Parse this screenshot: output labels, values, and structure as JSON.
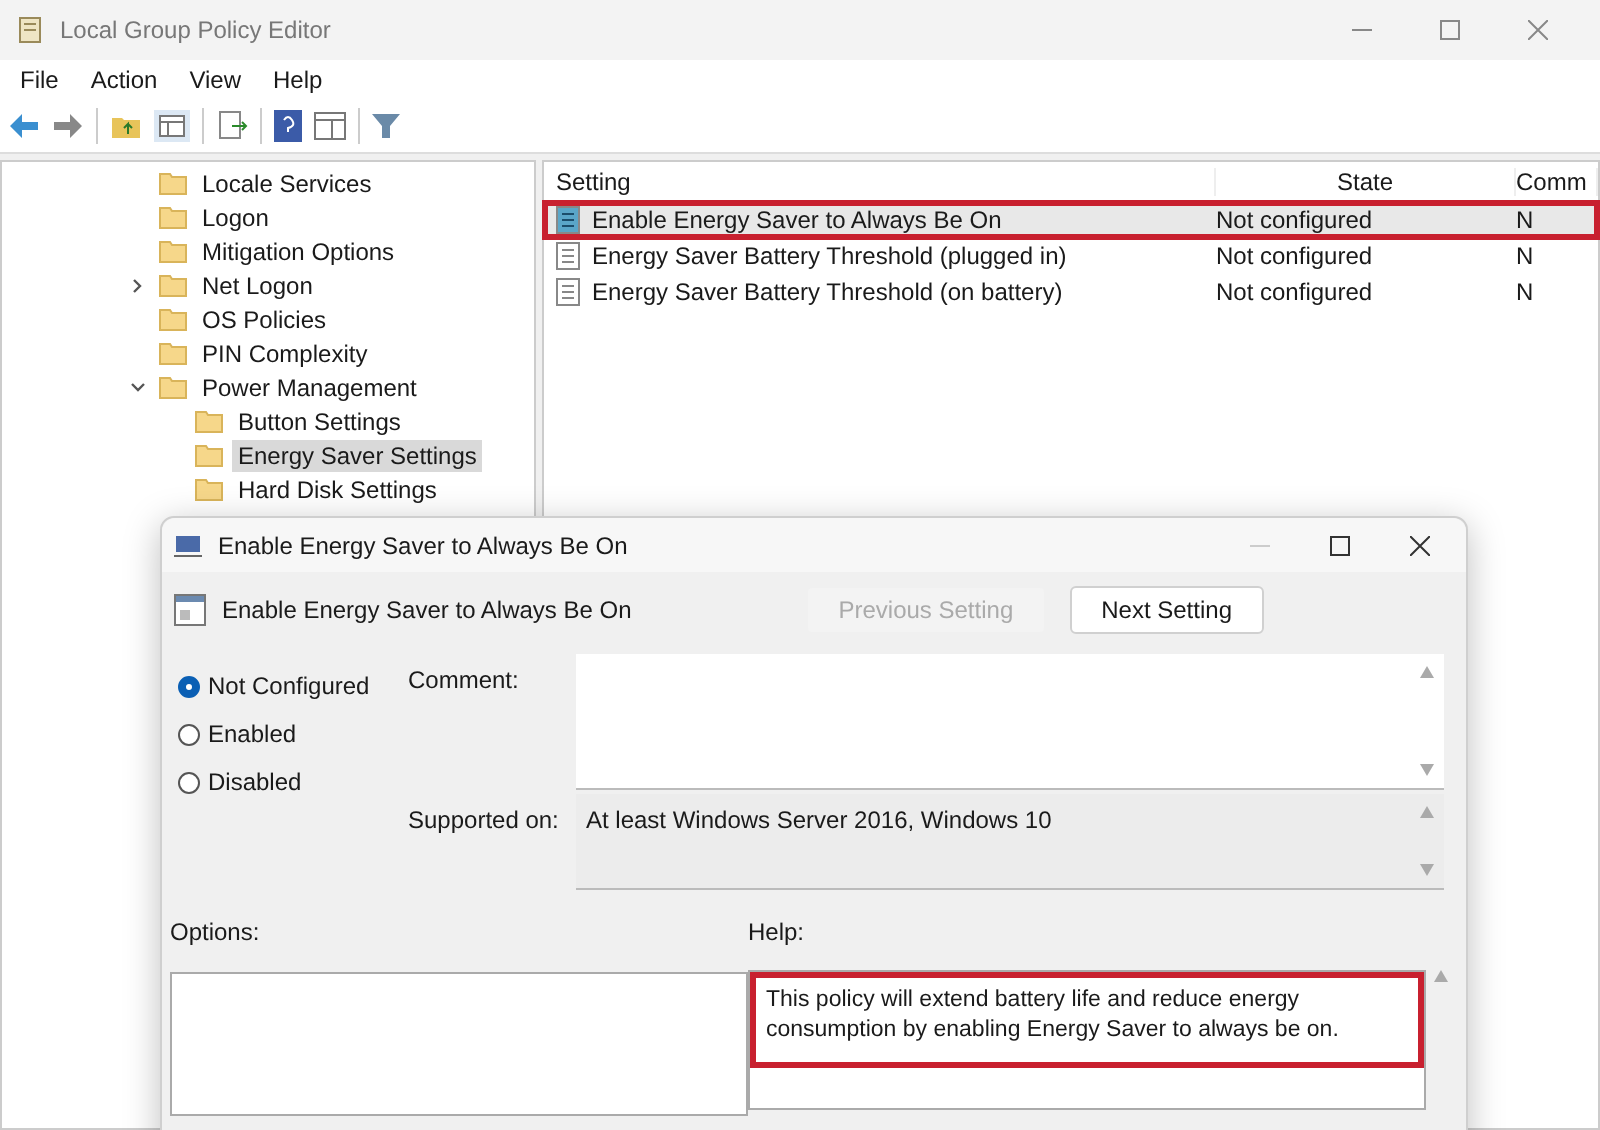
{
  "window": {
    "title": "Local Group Policy Editor"
  },
  "menu": [
    "File",
    "Action",
    "View",
    "Help"
  ],
  "tree": [
    {
      "label": "Locale Services",
      "kind": "leaf",
      "selected": false
    },
    {
      "label": "Logon",
      "kind": "leaf",
      "selected": false
    },
    {
      "label": "Mitigation Options",
      "kind": "leaf",
      "selected": false
    },
    {
      "label": "Net Logon",
      "kind": "collapsed",
      "selected": false
    },
    {
      "label": "OS Policies",
      "kind": "leaf",
      "selected": false
    },
    {
      "label": "PIN Complexity",
      "kind": "leaf",
      "selected": false
    },
    {
      "label": "Power Management",
      "kind": "expanded",
      "selected": false,
      "children": [
        {
          "label": "Button Settings",
          "selected": false
        },
        {
          "label": "Energy Saver Settings",
          "selected": true
        },
        {
          "label": "Hard Disk Settings",
          "selected": false
        }
      ]
    }
  ],
  "table": {
    "columns": [
      "Setting",
      "State",
      "Comm"
    ],
    "rows": [
      {
        "setting": "Enable Energy Saver to Always Be On",
        "state": "Not configured",
        "column_3": "N",
        "selected": true,
        "highlighted": true
      },
      {
        "setting": "Energy Saver Battery Threshold (plugged in)",
        "state": "Not configured",
        "column_3": "N",
        "selected": false,
        "highlighted": false
      },
      {
        "setting": "Energy Saver Battery Threshold (on battery)",
        "state": "Not configured",
        "column_3": "N",
        "selected": false,
        "highlighted": false
      }
    ]
  },
  "dialog": {
    "title": "Enable Energy Saver to Always Be On",
    "heading": "Enable Energy Saver to Always Be On",
    "buttons": [
      {
        "label": "Previous Setting",
        "disabled": true
      },
      {
        "label": "Next Setting",
        "disabled": false
      }
    ],
    "options": [
      {
        "label": "Not Configured",
        "selected": true
      },
      {
        "label": "Enabled",
        "selected": false
      },
      {
        "label": "Disabled",
        "selected": false
      }
    ],
    "comment_label": "Comment:",
    "supported_label": "Supported on:",
    "supported_value": "At least Windows Server 2016, Windows 10",
    "options_label": "Options:",
    "help_label": "Help:",
    "help_text": "This policy will extend battery life and reduce energy consumption by enabling Energy Saver to always be on.",
    "help_highlighted": true
  }
}
